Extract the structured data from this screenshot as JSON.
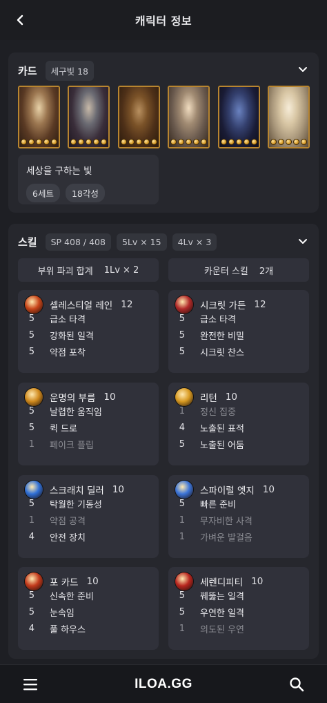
{
  "header": {
    "title": "캐릭터 정보"
  },
  "card_section": {
    "title": "카드",
    "badge": "세구빛 18",
    "card_count": 6,
    "set": {
      "name": "세상을 구하는 빛",
      "tags": [
        "6세트",
        "18각성"
      ]
    }
  },
  "skill_section": {
    "title": "스킬",
    "badges": [
      "SP 408 / 408",
      "5Lv × 15",
      "4Lv × 3"
    ],
    "summary": [
      {
        "label": "부위 파괴 합계",
        "value": "1Lv × 2"
      },
      {
        "label": "카운터 스킬",
        "value": "2개"
      }
    ],
    "skills": [
      {
        "name": "셀레스티얼 레인",
        "level": "12",
        "icon_color": "#c9461a",
        "tripods": [
          {
            "lv": "5",
            "name": "급소 타격",
            "active": true
          },
          {
            "lv": "5",
            "name": "강화된 일격",
            "active": true
          },
          {
            "lv": "5",
            "name": "약점 포착",
            "active": true
          }
        ]
      },
      {
        "name": "시크릿 가든",
        "level": "12",
        "icon_color": "#b22a2a",
        "tripods": [
          {
            "lv": "5",
            "name": "급소 타격",
            "active": true
          },
          {
            "lv": "5",
            "name": "완전한 비밀",
            "active": true
          },
          {
            "lv": "5",
            "name": "시크릿 찬스",
            "active": true
          }
        ]
      },
      {
        "name": "운명의 부름",
        "level": "10",
        "icon_color": "#d08a1e",
        "tripods": [
          {
            "lv": "5",
            "name": "날렵한 움직임",
            "active": true
          },
          {
            "lv": "5",
            "name": "퀵 드로",
            "active": true
          },
          {
            "lv": "1",
            "name": "페이크 플립",
            "active": false
          }
        ]
      },
      {
        "name": "리턴",
        "level": "10",
        "icon_color": "#d89a22",
        "tripods": [
          {
            "lv": "1",
            "name": "정신 집중",
            "active": false
          },
          {
            "lv": "4",
            "name": "노출된 표적",
            "active": true
          },
          {
            "lv": "5",
            "name": "노출된 어둠",
            "active": true
          }
        ]
      },
      {
        "name": "스크래치 딜러",
        "level": "10",
        "icon_color": "#2f6fd6",
        "tripods": [
          {
            "lv": "5",
            "name": "탁월한 기동성",
            "active": true
          },
          {
            "lv": "1",
            "name": "약점 공격",
            "active": false
          },
          {
            "lv": "4",
            "name": "안전 장치",
            "active": true
          }
        ]
      },
      {
        "name": "스파이럴 엣지",
        "level": "10",
        "icon_color": "#3b74d8",
        "tripods": [
          {
            "lv": "5",
            "name": "빠른 준비",
            "active": true
          },
          {
            "lv": "1",
            "name": "무자비한 사격",
            "active": false
          },
          {
            "lv": "1",
            "name": "가벼운 발걸음",
            "active": false
          }
        ]
      },
      {
        "name": "포 카드",
        "level": "10",
        "icon_color": "#c23a1c",
        "tripods": [
          {
            "lv": "5",
            "name": "신속한 준비",
            "active": true
          },
          {
            "lv": "5",
            "name": "눈속임",
            "active": true
          },
          {
            "lv": "4",
            "name": "풀 하우스",
            "active": true
          }
        ]
      },
      {
        "name": "세렌디피티",
        "level": "10",
        "icon_color": "#b8261f",
        "tripods": [
          {
            "lv": "5",
            "name": "꿰뚫는 일격",
            "active": true
          },
          {
            "lv": "5",
            "name": "우연한 일격",
            "active": true
          },
          {
            "lv": "1",
            "name": "의도된 우연",
            "active": false
          }
        ]
      }
    ]
  },
  "bottom_bar": {
    "logo": "ILOA.GG"
  },
  "icons": {
    "back": "chevron-left-icon",
    "collapse": "chevron-down-icon",
    "menu": "hamburger-menu-icon",
    "search": "search-icon"
  },
  "colors": {
    "background": "#1e1f24",
    "panel": "#26272d",
    "card_border": "#b8852f",
    "inactive_text": "#8b8c93"
  }
}
